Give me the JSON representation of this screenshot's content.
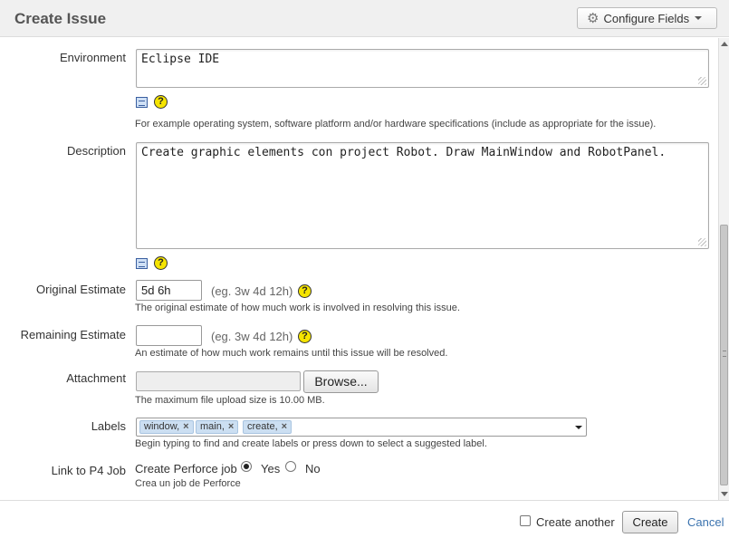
{
  "dialog": {
    "title": "Create Issue",
    "configure_label": "Configure Fields"
  },
  "fields": {
    "environment": {
      "label": "Environment",
      "value": "Eclipse IDE",
      "help": "For example operating system, software platform and/or hardware specifications (include as appropriate for the issue)."
    },
    "description": {
      "label": "Description",
      "value": "Create graphic elements con project Robot. Draw MainWindow and RobotPanel."
    },
    "original_estimate": {
      "label": "Original Estimate",
      "value": "5d 6h",
      "hint": "(eg. 3w 4d 12h)",
      "help": "The original estimate of how much work is involved in resolving this issue."
    },
    "remaining_estimate": {
      "label": "Remaining Estimate",
      "value": "",
      "hint": "(eg. 3w 4d 12h)",
      "help": "An estimate of how much work remains until this issue will be resolved."
    },
    "attachment": {
      "label": "Attachment",
      "browse_label": "Browse...",
      "help": "The maximum file upload size is 10.00 MB."
    },
    "labels": {
      "label": "Labels",
      "tags": [
        "window,",
        "main,",
        "create,"
      ],
      "help": "Begin typing to find and create labels or press down to select a suggested label."
    },
    "p4_job": {
      "label": "Link to P4 Job",
      "prompt": "Create Perforce job",
      "yes_label": "Yes",
      "no_label": "No",
      "selected": "Yes",
      "help": "Crea un job de Perforce"
    }
  },
  "help_glyph": "?",
  "tag_remove_glyph": "×",
  "footer": {
    "create_another_label": "Create another",
    "create_another_checked": false,
    "create_label": "Create",
    "cancel_label": "Cancel"
  }
}
